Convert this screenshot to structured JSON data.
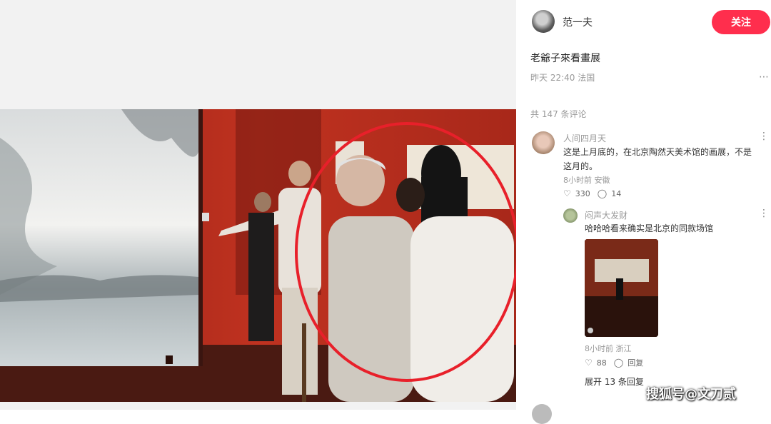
{
  "author": {
    "name": "范一夫",
    "follow_label": "关注"
  },
  "post": {
    "title": "老爺子來看畫展",
    "meta": "昨天 22:40 法国",
    "comment_count": "共 147 条评论"
  },
  "comments": [
    {
      "user": "人间四月天",
      "text": "这是上月底的，在北京陶然天美术馆的画展，不是这月的。",
      "meta": "8小时前 安徽",
      "likes": "330",
      "replies": "14",
      "reply": {
        "user": "闷声大发财",
        "text": "哈哈哈看来确实是北京的同款场馆",
        "meta": "8小时前 浙江",
        "likes": "88",
        "reply_label": "回复"
      }
    }
  ],
  "expand_label": "展开 13 条回复",
  "watermark": "搜狐号@文刀贰",
  "colors": {
    "follow": "#ff2e4d",
    "wall_red": "#b52a1c",
    "circle": "#e8202a"
  }
}
